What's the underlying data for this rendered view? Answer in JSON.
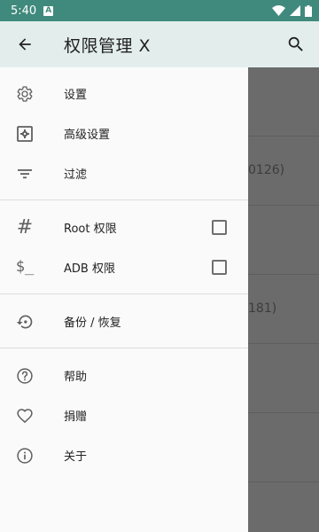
{
  "status_bar": {
    "time": "5:40",
    "notification_letter": "A",
    "background_color": "#408a7d"
  },
  "app_bar": {
    "title": "权限管理 X",
    "back_icon": "arrow-left-icon",
    "search_icon": "search-icon"
  },
  "drawer": {
    "section1": [
      {
        "label": "设置",
        "icon": "gear-icon"
      },
      {
        "label": "高级设置",
        "icon": "advanced-settings-icon"
      },
      {
        "label": "过滤",
        "icon": "filter-icon"
      }
    ],
    "section2": [
      {
        "label": "Root 权限",
        "icon": "hash-icon",
        "checked": false
      },
      {
        "label": "ADB 权限",
        "icon": "dollar-prompt-icon",
        "checked": false
      }
    ],
    "section3": [
      {
        "label": "备份 / 恢复",
        "icon": "restore-icon"
      }
    ],
    "section4": [
      {
        "label": "帮助",
        "icon": "help-icon"
      },
      {
        "label": "捐赠",
        "icon": "heart-icon"
      },
      {
        "label": "关于",
        "icon": "info-icon"
      }
    ]
  },
  "background_list": {
    "peek_texts": [
      "0126)",
      "181)"
    ]
  }
}
